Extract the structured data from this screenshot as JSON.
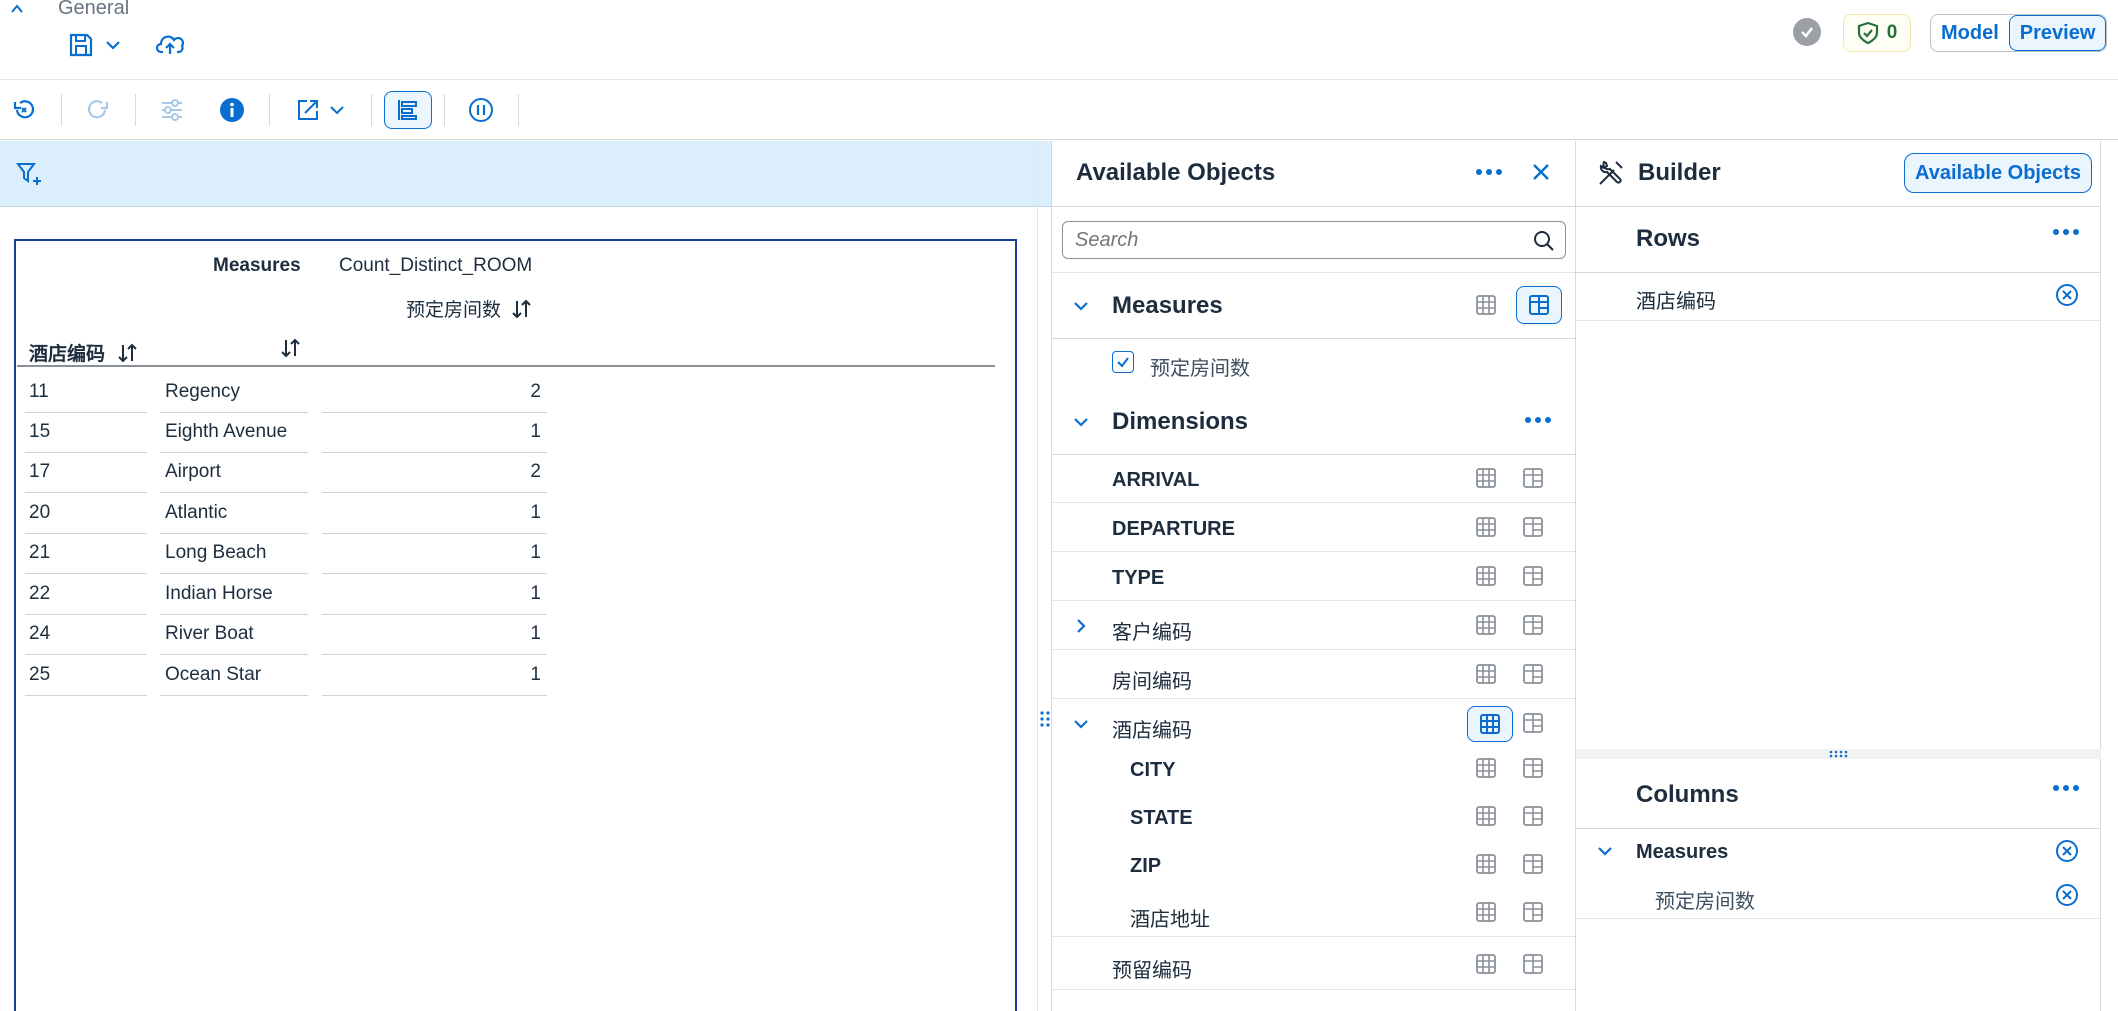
{
  "header": {
    "title": "General",
    "status_count": "0",
    "mode_model": "Model",
    "mode_preview": "Preview"
  },
  "table": {
    "measures_label": "Measures",
    "measure_name": "Count_Distinct_ROOM",
    "measure_desc": "预定房间数",
    "dimension_header": "酒店编码",
    "rows": [
      {
        "code": "11",
        "name": "Regency",
        "value": "2"
      },
      {
        "code": "15",
        "name": "Eighth Avenue",
        "value": "1"
      },
      {
        "code": "17",
        "name": "Airport",
        "value": "2"
      },
      {
        "code": "20",
        "name": "Atlantic",
        "value": "1"
      },
      {
        "code": "21",
        "name": "Long Beach",
        "value": "1"
      },
      {
        "code": "22",
        "name": "Indian Horse",
        "value": "1"
      },
      {
        "code": "24",
        "name": "River Boat",
        "value": "1"
      },
      {
        "code": "25",
        "name": "Ocean Star",
        "value": "1"
      }
    ]
  },
  "available_objects": {
    "title": "Available Objects",
    "search_placeholder": "Search",
    "measures_label": "Measures",
    "measure_items": [
      "预定房间数"
    ],
    "dimensions_label": "Dimensions",
    "dimension_items": [
      "ARRIVAL",
      "DEPARTURE",
      "TYPE",
      "客户编码",
      "房间编码",
      "酒店编码",
      "CITY",
      "STATE",
      "ZIP",
      "酒店地址",
      "预留编码"
    ]
  },
  "builder": {
    "title": "Builder",
    "available_objects_button": "Available Objects",
    "rows_label": "Rows",
    "row_items": [
      "酒店编码"
    ],
    "columns_label": "Columns",
    "column_group": "Measures",
    "column_items": [
      "预定房间数"
    ]
  },
  "colors": {
    "accent": "#0a6ed1",
    "filter_bar": "#dbeefb",
    "table_border": "#1a3f9e",
    "status_ok": "#256f3a"
  }
}
